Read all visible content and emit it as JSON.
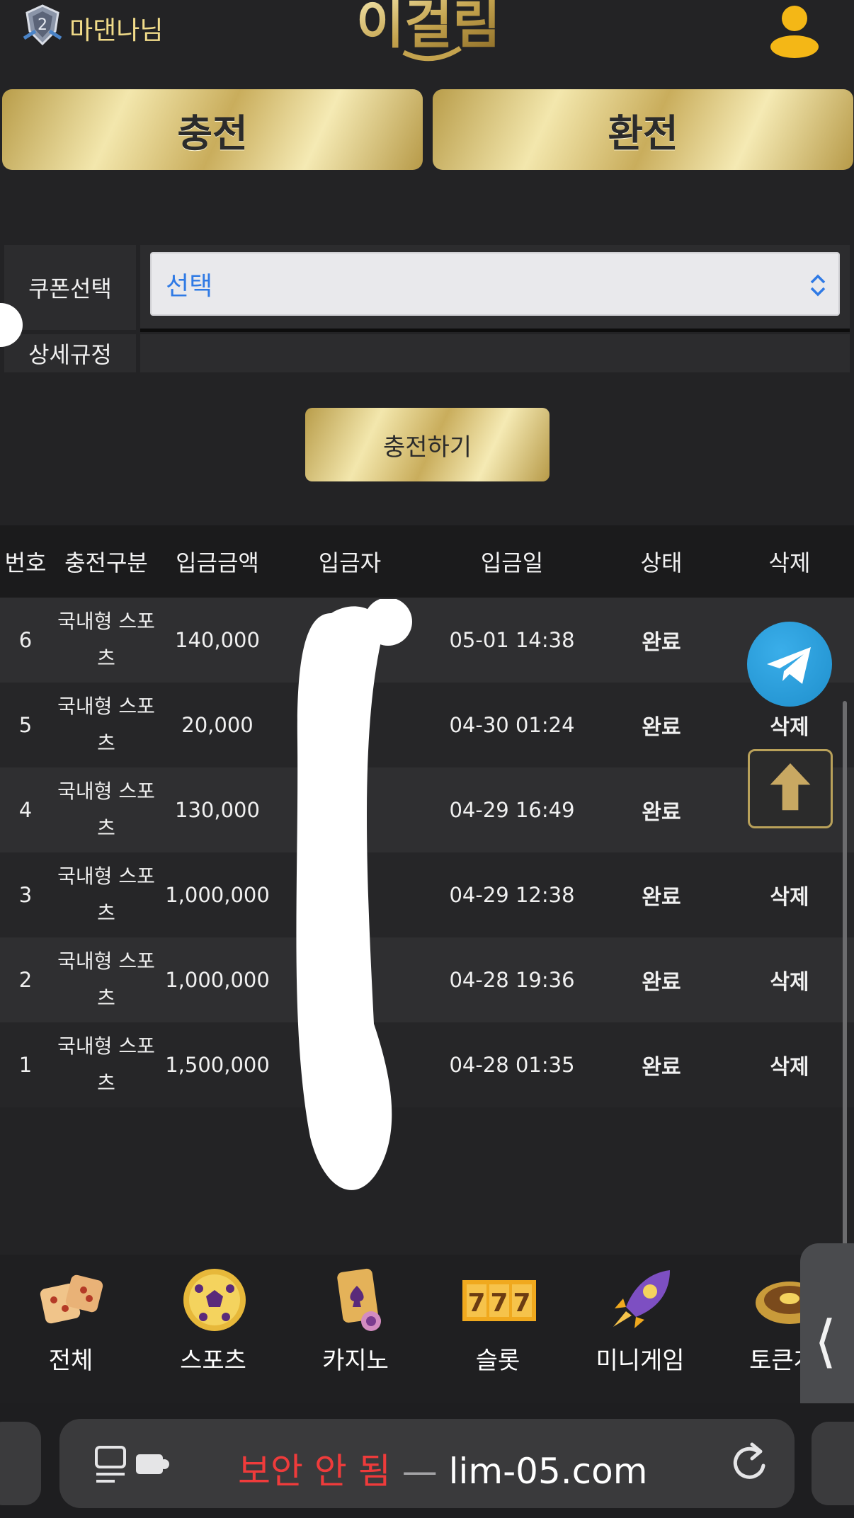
{
  "header": {
    "username": "마댄나님",
    "logo_text": "이걸림"
  },
  "actions": {
    "charge_label": "충전",
    "exchange_label": "환전"
  },
  "coupon_form": {
    "coupon_label": "쿠폰선택",
    "coupon_selected": "선택",
    "rules_label": "상세규정",
    "rules_value": ""
  },
  "submit_label": "충전하기",
  "table": {
    "headers": [
      "번호",
      "충전구분",
      "입금금액",
      "입금자",
      "입금일",
      "상태",
      "삭제"
    ],
    "rows": [
      {
        "no": "6",
        "type": "국내형 스포츠",
        "amount": "140,000",
        "depositor": "",
        "date": "05-01 14:38",
        "status": "완료",
        "delete": ""
      },
      {
        "no": "5",
        "type": "국내형 스포츠",
        "amount": "20,000",
        "depositor": "",
        "date": "04-30 01:24",
        "status": "완료",
        "delete": "삭제"
      },
      {
        "no": "4",
        "type": "국내형 스포츠",
        "amount": "130,000",
        "depositor": "",
        "date": "04-29 16:49",
        "status": "완료",
        "delete": ""
      },
      {
        "no": "3",
        "type": "국내형 스포츠",
        "amount": "1,000,000",
        "depositor": "",
        "date": "04-29 12:38",
        "status": "완료",
        "delete": "삭제"
      },
      {
        "no": "2",
        "type": "국내형 스포츠",
        "amount": "1,000,000",
        "depositor": "",
        "date": "04-28 19:36",
        "status": "완료",
        "delete": "삭제"
      },
      {
        "no": "1",
        "type": "국내형 스포츠",
        "amount": "1,500,000",
        "depositor": "",
        "date": "04-28 01:35",
        "status": "완료",
        "delete": "삭제"
      }
    ]
  },
  "floating": {
    "telegram_icon": "telegram-icon",
    "scroll_top_icon": "arrow-up-icon"
  },
  "game_nav": [
    {
      "label": "전체",
      "icon": "dice-icon"
    },
    {
      "label": "스포츠",
      "icon": "soccer-ball-icon"
    },
    {
      "label": "카지노",
      "icon": "playing-card-icon"
    },
    {
      "label": "슬롯",
      "icon": "slot-777-icon"
    },
    {
      "label": "미니게임",
      "icon": "rocket-icon"
    },
    {
      "label": "토큰게",
      "icon": "roulette-icon"
    }
  ],
  "browser": {
    "insecure_label": "보안 안 됨",
    "separator": "—",
    "domain": "lim-05.com"
  },
  "colors": {
    "background": "#232325",
    "gold_light": "#f3e7ad",
    "gold_dark": "#b99d4a",
    "select_text": "#2f7ae5",
    "insecure_red": "#ef3b3b",
    "telegram_blue": "#2ea6e3"
  }
}
